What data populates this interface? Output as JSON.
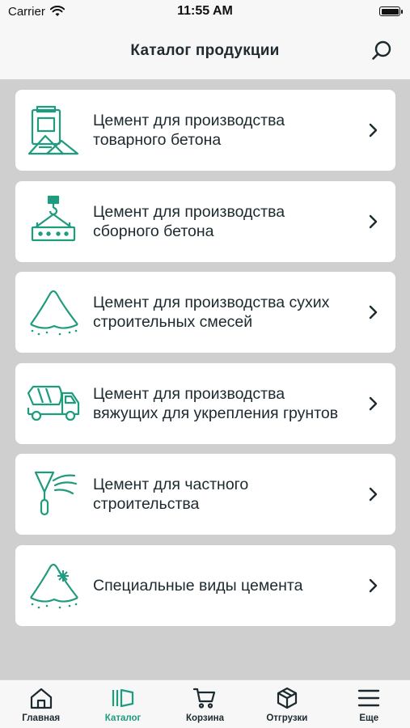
{
  "status_bar": {
    "carrier": "Carrier",
    "time": "11:55 AM"
  },
  "header": {
    "title": "Каталог продукции"
  },
  "accent_color": "#1f9b7e",
  "catalog": {
    "items": [
      {
        "icon": "cement-bags-icon",
        "label": "Цемент для производства\nтоварного бетона"
      },
      {
        "icon": "crane-hook-block-icon",
        "label": "Цемент для производства\nсборного бетона"
      },
      {
        "icon": "powder-pile-icon",
        "label": "Цемент для производства сухих\nстроительных смесей"
      },
      {
        "icon": "concrete-mixer-truck-icon",
        "label": "Цемент для производства\nвяжущих для укрепления грунтов"
      },
      {
        "icon": "trowel-icon",
        "label": "Цемент для частного\nстроительства"
      },
      {
        "icon": "special-cement-icon",
        "label": "Специальные виды цемента"
      }
    ]
  },
  "tab_bar": {
    "tabs": [
      {
        "icon": "home-icon",
        "label": "Главная",
        "active": false
      },
      {
        "icon": "catalog-icon",
        "label": "Каталог",
        "active": true
      },
      {
        "icon": "cart-icon",
        "label": "Корзина",
        "active": false
      },
      {
        "icon": "box-icon",
        "label": "Отгрузки",
        "active": false
      },
      {
        "icon": "menu-icon",
        "label": "Еще",
        "active": false
      }
    ]
  }
}
